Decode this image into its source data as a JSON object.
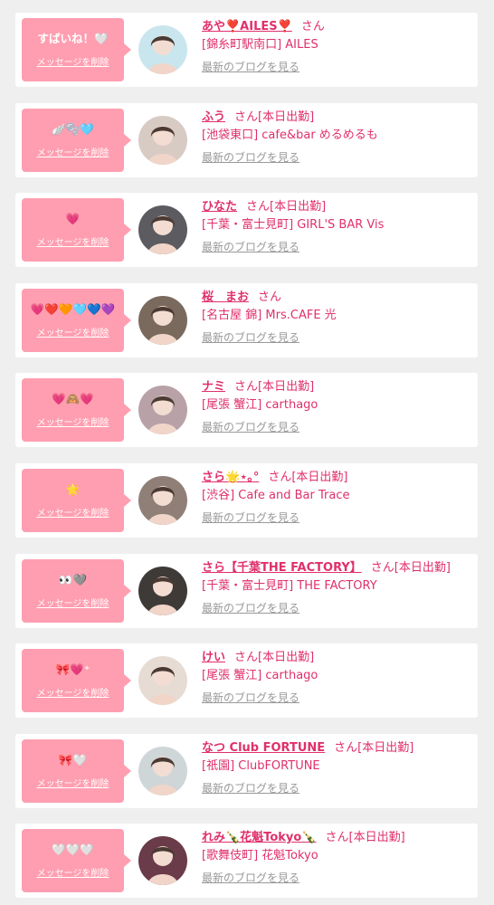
{
  "colors": {
    "background": "#efefef",
    "card": "#ffffff",
    "bubble": "#ff9eb0",
    "accent": "#e0306a",
    "muted": "#999999"
  },
  "items": [
    {
      "message": "すばいね！🤍",
      "delete_label": "メッセージを削除",
      "name": "あや❣️AILES❣️",
      "suffix": "さん",
      "shop": "[錦糸町駅南口] AILES",
      "blog_link": "最新のブログを見る",
      "avatar_icon": "profile-photo",
      "avatar_tone": "#c9e6ee"
    },
    {
      "message": "🪽🫧🩵",
      "delete_label": "メッセージを削除",
      "name": "ふう",
      "suffix": "さん[本日出勤]",
      "shop": "[池袋東口] cafe&bar めるめるも",
      "blog_link": "最新のブログを見る",
      "avatar_icon": "profile-photo",
      "avatar_tone": "#d8cbc4"
    },
    {
      "message": "💗",
      "delete_label": "メッセージを削除",
      "name": "ひなた",
      "suffix": "さん[本日出勤]",
      "shop": "[千葉・富士見町] GIRL'S BAR Vis",
      "blog_link": "最新のブログを見る",
      "avatar_icon": "profile-photo",
      "avatar_tone": "#5b5b60"
    },
    {
      "message": "💗❤️🧡🩵💙💜",
      "delete_label": "メッセージを削除",
      "name": "桜　まお",
      "suffix": "さん",
      "shop": "[名古屋 錦] Mrs.CAFE 光",
      "blog_link": "最新のブログを見る",
      "avatar_icon": "profile-photo",
      "avatar_tone": "#7a6a5e"
    },
    {
      "message": "💗🙈💗",
      "delete_label": "メッセージを削除",
      "name": "ナミ",
      "suffix": "さん[本日出勤]",
      "shop": "[尾張 蟹江] carthago",
      "blog_link": "最新のブログを見る",
      "avatar_icon": "profile-photo",
      "avatar_tone": "#b8a2a8"
    },
    {
      "message": "🌟",
      "delete_label": "メッセージを削除",
      "name": "さら🌟⋆｡°",
      "suffix": "さん[本日出勤]",
      "shop": "[渋谷] Cafe and Bar Trace",
      "blog_link": "最新のブログを見る",
      "avatar_icon": "profile-photo",
      "avatar_tone": "#8f7f76"
    },
    {
      "message": "👀🩶",
      "delete_label": "メッセージを削除",
      "name": "さら【千葉THE FACTORY】",
      "suffix": "さん[本日出勤]",
      "shop": "[千葉・富士見町] THE FACTORY",
      "blog_link": "最新のブログを見る",
      "avatar_icon": "profile-photo",
      "avatar_tone": "#3e3a38"
    },
    {
      "message": "🎀💗⁺",
      "delete_label": "メッセージを削除",
      "name": "けい",
      "suffix": "さん[本日出勤]",
      "shop": "[尾張 蟹江] carthago",
      "blog_link": "最新のブログを見る",
      "avatar_icon": "profile-photo",
      "avatar_tone": "#e6dcd4"
    },
    {
      "message": "🎀🤍",
      "delete_label": "メッセージを削除",
      "name": "なつ Club FORTUNE",
      "suffix": "さん[本日出勤]",
      "shop": "[祇園] ClubFORTUNE",
      "blog_link": "最新のブログを見る",
      "avatar_icon": "profile-photo",
      "avatar_tone": "#cfd6d8"
    },
    {
      "message": "🤍🤍🤍",
      "delete_label": "メッセージを削除",
      "name": "れみ🍾花魁Tokyo🍾",
      "suffix": "さん[本日出勤]",
      "shop": "[歌舞伎町] 花魁Tokyo",
      "blog_link": "最新のブログを見る",
      "avatar_icon": "profile-photo",
      "avatar_tone": "#6a3b48"
    }
  ]
}
